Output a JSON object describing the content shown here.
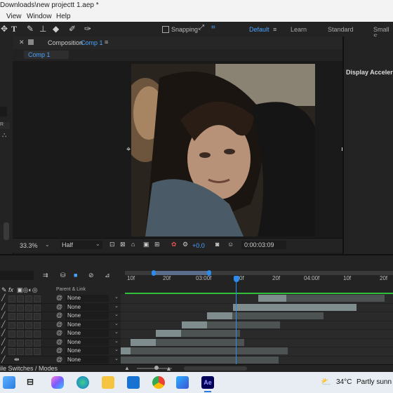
{
  "title_bar": {
    "title": "Downloads\\new projectt 1.aep *"
  },
  "menu": {
    "items": [
      "View",
      "Window",
      "Help"
    ]
  },
  "toolbar": {
    "snapping_label": "Snapping",
    "workspaces": [
      "Default",
      "Learn",
      "Standard",
      "Small S"
    ],
    "active_workspace": "Default"
  },
  "composition_panel": {
    "header_label": "Composition",
    "header_comp": "Comp 1",
    "tab_label": "Comp 1",
    "zoom": "33.3%",
    "resolution": "Half",
    "exposure": "+0.0",
    "timecode": "0:00:03:09"
  },
  "right_panel": {
    "title": "Display Acceleration"
  },
  "timeline": {
    "ruler_labels": [
      "10f",
      "20f",
      "03:00f",
      "0f",
      "20f",
      "04:00f",
      "10f",
      "20f"
    ],
    "parent_link_header": "Parent & Link",
    "parent_value": "None",
    "footer_label": "ile Switches / Modes",
    "layer_count": 8
  },
  "taskbar": {
    "weather_temp": "34°C",
    "weather_text": "Partly sunn",
    "ae_label": "Ae"
  },
  "colors": {
    "accent": "#2d8ceb",
    "playhead": "#2d8ceb",
    "bar": "#4d5353",
    "bar_selected": "#7f8d8e",
    "work_area_green": "#2fbf3a"
  }
}
